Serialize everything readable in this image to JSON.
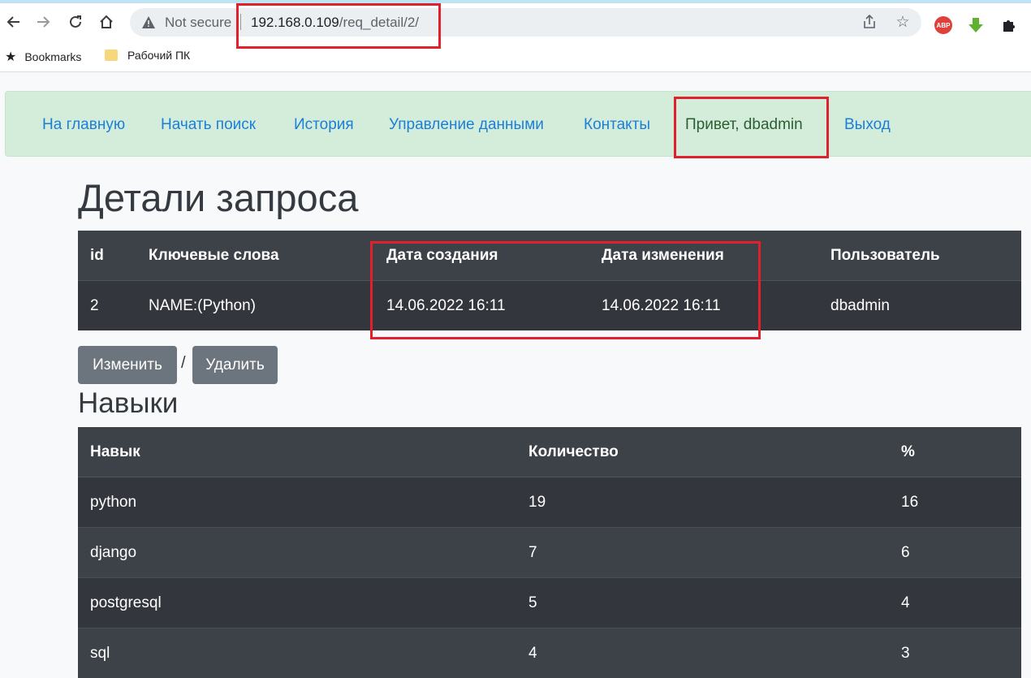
{
  "browser": {
    "not_secure": "Not secure",
    "url_host": "192.168.0.109",
    "url_path": "/req_detail/2/",
    "bookmarks": [
      {
        "label": "Bookmarks"
      },
      {
        "label": "Рабочий ПК"
      }
    ],
    "abp_label": "ABP"
  },
  "nav": {
    "items": [
      {
        "label": "На главную"
      },
      {
        "label": "Начать поиск"
      },
      {
        "label": "История"
      },
      {
        "label": "Управление данными"
      },
      {
        "label": "Контакты"
      },
      {
        "label": "Привет, dbadmin"
      },
      {
        "label": "Выход"
      }
    ]
  },
  "page": {
    "title": "Детали запроса",
    "request_table": {
      "headers": [
        "id",
        "Ключевые слова",
        "Дата создания",
        "Дата изменения",
        "Пользователь"
      ],
      "row": [
        "2",
        "NAME:(Python)",
        "14.06.2022 16:11",
        "14.06.2022 16:11",
        "dbadmin"
      ]
    },
    "edit_label": "Изменить",
    "separator": "/",
    "delete_label": "Удалить",
    "skills_title": "Навыки",
    "skills_table": {
      "headers": [
        "Навык",
        "Количество",
        "%"
      ],
      "rows": [
        [
          "python",
          "19",
          "16"
        ],
        [
          "django",
          "7",
          "6"
        ],
        [
          "postgresql",
          "5",
          "4"
        ],
        [
          "sql",
          "4",
          "3"
        ]
      ]
    }
  },
  "colors": {
    "highlight": "#e0212b",
    "nav_bg": "#d4edda",
    "link": "#1b7fd8",
    "table_dark": "#343a40",
    "button": "#6c757d"
  }
}
